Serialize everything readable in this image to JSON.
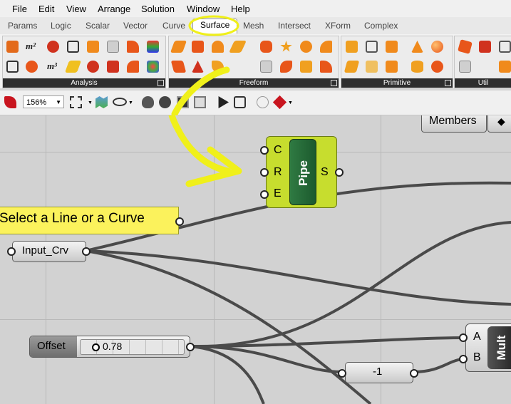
{
  "menu": [
    "File",
    "Edit",
    "View",
    "Arrange",
    "Solution",
    "Window",
    "Help"
  ],
  "tabs": [
    "Params",
    "Logic",
    "Scalar",
    "Vector",
    "Curve",
    "Surface",
    "Mesh",
    "Intersect",
    "XForm",
    "Complex"
  ],
  "active_tab": "Surface",
  "ribbon_panels": [
    "Analysis",
    "Freeform",
    "Primitive",
    "Util"
  ],
  "toolbar": {
    "zoom": "156%"
  },
  "canvas": {
    "members_button": "Members",
    "pipe": {
      "title": "Pipe",
      "inputs": [
        "C",
        "R",
        "E"
      ],
      "output": "S"
    },
    "panel_note": "Select a Line or a Curve",
    "input_crv": "Input_Crv",
    "offset_label": "Offset",
    "slider_value": "0.78",
    "neg_one": "-1",
    "mult": {
      "title": "Mult",
      "inputs": [
        "A",
        "B"
      ]
    }
  },
  "colors": {
    "pipe_body": "#c7dd2e",
    "pipe_title": "#1c5a2e",
    "panel_note": "#fbf25c",
    "annotation": "#f0f01a",
    "icon_orange": "#f08a1c",
    "icon_red": "#d0321e"
  }
}
